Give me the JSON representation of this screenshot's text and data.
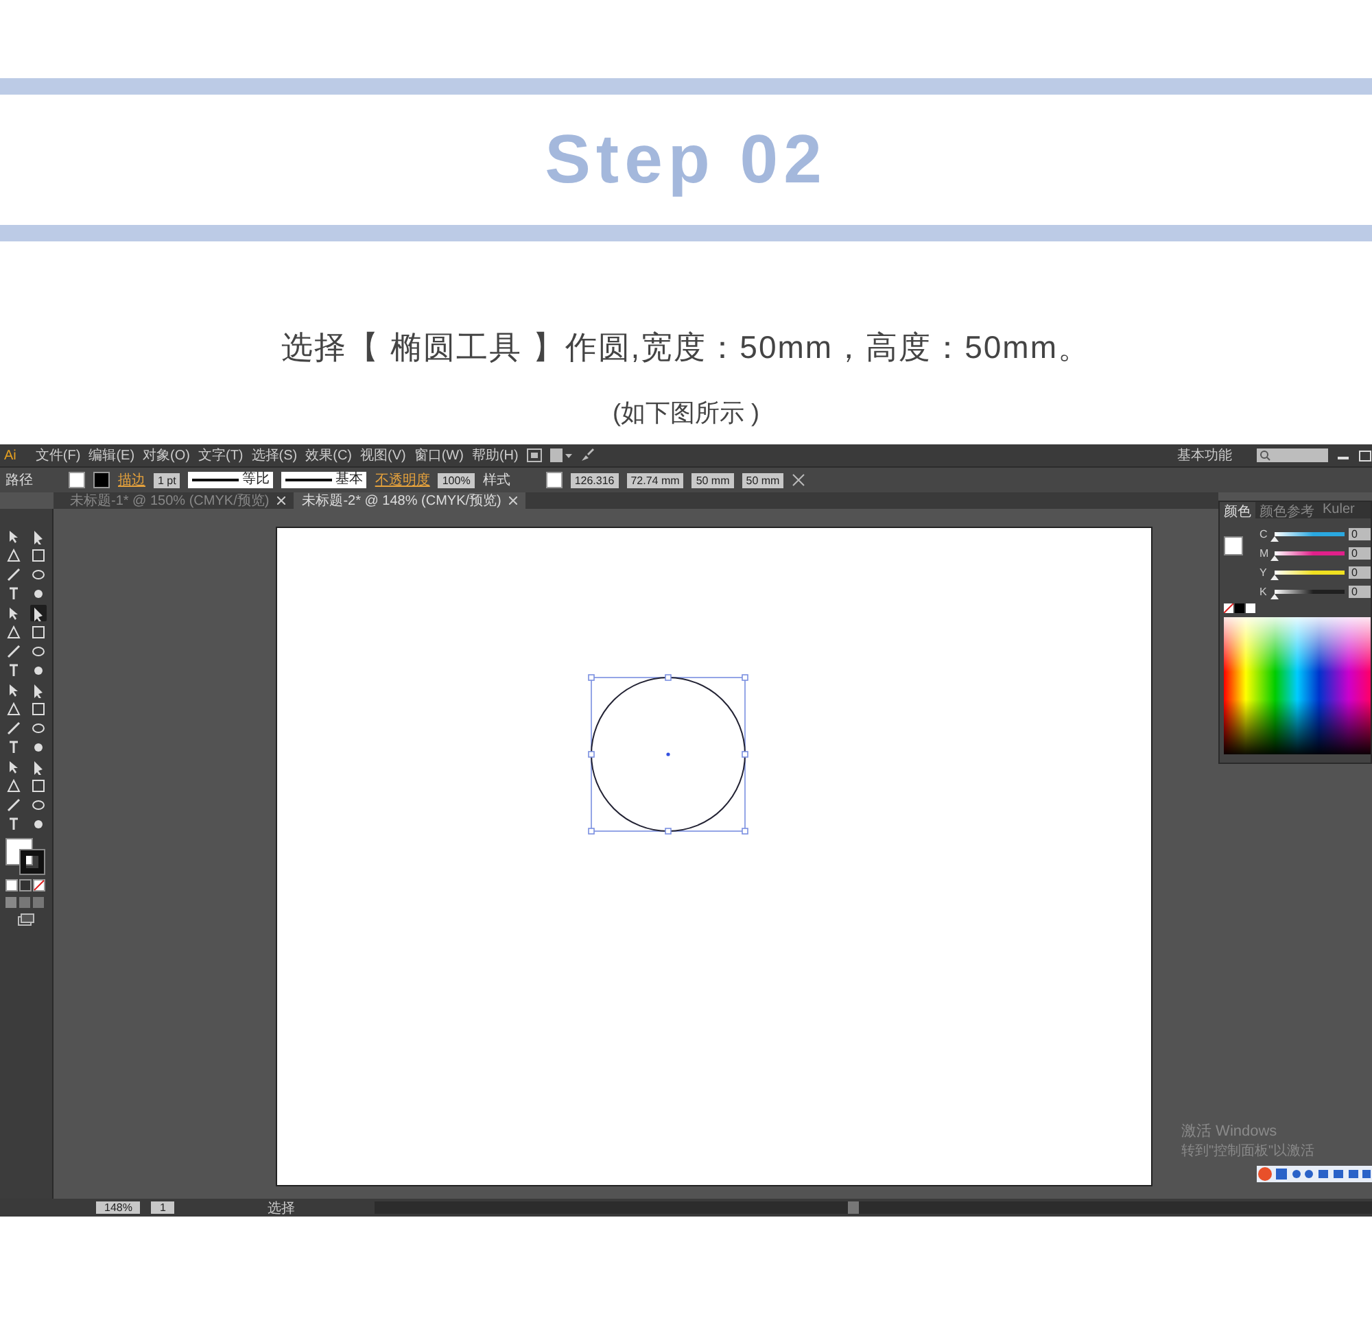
{
  "header": {
    "title": "Step 02",
    "instruction": "选择【 椭圆工具 】作圆,宽度：50mm，高度：50mm。",
    "caption": "(如下图所示 )"
  },
  "app": {
    "logo": "Ai",
    "menu": [
      "文件(F)",
      "编辑(E)",
      "对象(O)",
      "文字(T)",
      "选择(S)",
      "效果(C)",
      "视图(V)",
      "窗口(W)",
      "帮助(H)"
    ],
    "workspace": "基本功能",
    "controls": [
      {
        "kind": "label",
        "text": "路径"
      },
      {
        "kind": "swatch",
        "color": "#ffffff"
      },
      {
        "kind": "swatch",
        "color": "#000000"
      },
      {
        "kind": "link",
        "text": "描边"
      },
      {
        "kind": "field",
        "value": "1 pt"
      },
      {
        "kind": "stroke",
        "text": "等比"
      },
      {
        "kind": "stroke",
        "text": "基本"
      },
      {
        "kind": "link",
        "text": "不透明度"
      },
      {
        "kind": "field",
        "value": "100%"
      },
      {
        "kind": "label",
        "text": "样式"
      },
      {
        "kind": "swatch",
        "color": "#ffffff"
      },
      {
        "kind": "field",
        "value": "126.316"
      },
      {
        "kind": "field",
        "value": "72.74 mm"
      },
      {
        "kind": "field",
        "value": "50 mm"
      },
      {
        "kind": "field",
        "value": "50 mm"
      }
    ],
    "documents": [
      {
        "title": "未标题-1* @ 150% (CMYK/预览)",
        "selected": false
      },
      {
        "title": "未标题-2* @ 148% (CMYK/预览)",
        "selected": true
      }
    ],
    "tools": [
      {
        "selected": false
      },
      {
        "selected": false
      },
      {
        "selected": false
      },
      {
        "selected": false
      },
      {
        "selected": false
      },
      {
        "selected": false
      },
      {
        "selected": false
      },
      {
        "selected": false
      },
      {
        "selected": false
      },
      {
        "selected": true
      },
      {
        "selected": false
      },
      {
        "selected": false
      },
      {
        "selected": false
      },
      {
        "selected": false
      },
      {
        "selected": false
      },
      {
        "selected": false
      },
      {
        "selected": false
      },
      {
        "selected": false
      },
      {
        "selected": false
      },
      {
        "selected": false
      },
      {
        "selected": false
      },
      {
        "selected": false
      },
      {
        "selected": false
      },
      {
        "selected": false
      },
      {
        "selected": false
      },
      {
        "selected": false
      },
      {
        "selected": false
      },
      {
        "selected": false
      },
      {
        "selected": false
      },
      {
        "selected": false
      },
      {
        "selected": false
      },
      {
        "selected": false
      }
    ],
    "color_panel": {
      "tabs": [
        {
          "label": "颜色",
          "selected": true
        },
        {
          "label": "颜色参考",
          "selected": false
        },
        {
          "label": "Kuler",
          "selected": false
        }
      ],
      "channels": [
        {
          "name": "C",
          "color": "#2aa8e0",
          "level": 0,
          "value": "0"
        },
        {
          "name": "M",
          "color": "#e0208a",
          "level": 0,
          "value": "0"
        },
        {
          "name": "Y",
          "color": "#f0e020",
          "level": 0,
          "value": "0"
        },
        {
          "name": "K",
          "color": "#202020",
          "level": 0,
          "value": "0"
        }
      ]
    },
    "status": {
      "zoom": "148%",
      "artboard": "1",
      "tool": "选择"
    },
    "activation": {
      "title": "激活 Windows",
      "hint": "转到\"控制面板\"以激活"
    }
  }
}
